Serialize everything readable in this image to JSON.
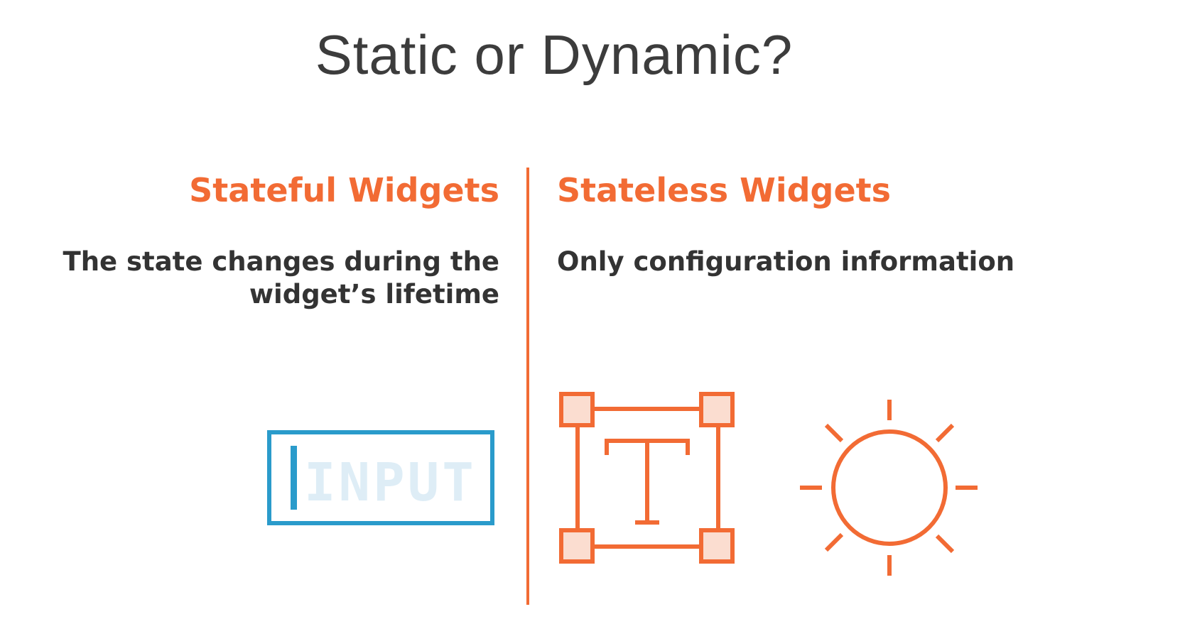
{
  "slide": {
    "title": "Static or Dynamic?"
  },
  "left": {
    "heading": "Stateful Widgets",
    "description_line1": "The state changes during the",
    "description_line2": "widget’s lifetime",
    "icon": "input-field-icon",
    "icon_text": "INPUT"
  },
  "right": {
    "heading": "Stateless Widgets",
    "description": "Only configuration information",
    "icons": [
      "text-box-icon",
      "sun-icon"
    ],
    "icon_text": "T"
  },
  "colors": {
    "accent": "#f26b34",
    "input_blue": "#2a9bcb",
    "input_text": "#deedf6",
    "handle_fill": "#fbddd0",
    "title": "#3c3c3c",
    "body_text": "#333333"
  }
}
